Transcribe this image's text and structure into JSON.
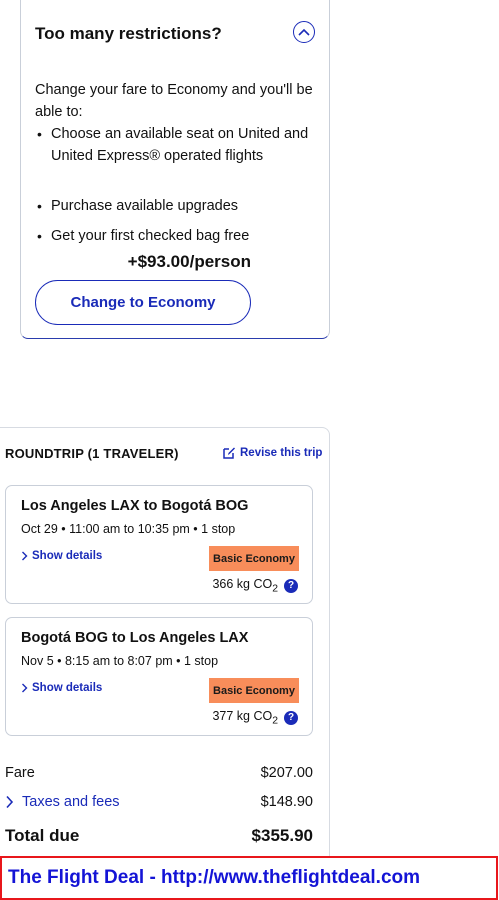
{
  "upsell": {
    "title": "Too many restrictions?",
    "body": "Change your fare to Economy and you'll be able to:",
    "bullets": [
      "Choose an available seat on United and United Express® operated flights",
      "Purchase available upgrades",
      "Get your first checked bag free"
    ],
    "price": "+$93.00/person",
    "button_label": "Change to Economy",
    "collapse_icon": "chevron-up-circle-icon"
  },
  "summary": {
    "heading": "ROUNDTRIP (1 TRAVELER)",
    "revise_label": "Revise this trip",
    "flights": [
      {
        "route": "Los Angeles LAX to Bogotá BOG",
        "times": "Oct 29 • 11:00 am to 10:35 pm • 1 stop",
        "show_details": "Show details",
        "fare_class": "Basic Economy",
        "co2_value": "366 kg CO",
        "co2_sub": "2"
      },
      {
        "route": "Bogotá BOG to Los Angeles LAX",
        "times": "Nov 5 • 8:15 am to 8:07 pm • 1 stop",
        "show_details": "Show details",
        "fare_class": "Basic Economy",
        "co2_value": "377 kg CO",
        "co2_sub": "2"
      }
    ],
    "fare_label": "Fare",
    "fare_value": "$207.00",
    "taxes_label": "Taxes and fees",
    "taxes_value": "$148.90",
    "total_label": "Total due",
    "total_value": "$355.90"
  },
  "watermark": "The Flight Deal - http://www.theflightdeal.com",
  "colors": {
    "accent": "#1a2bb8",
    "badge": "#f88d5a",
    "watermark_border": "#e8161b",
    "watermark_text": "#1414d6"
  }
}
